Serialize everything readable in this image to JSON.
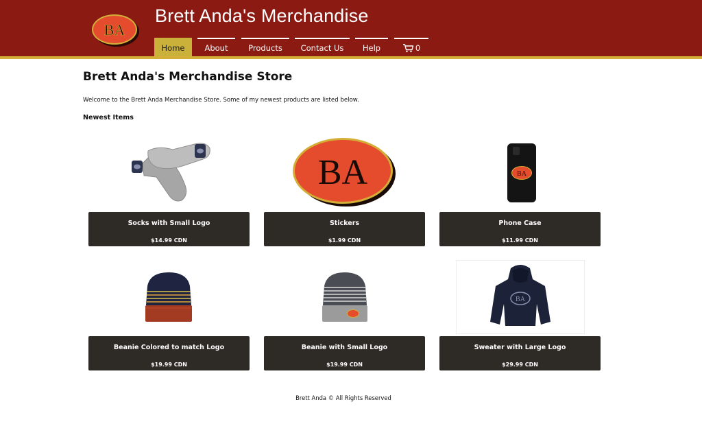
{
  "site": {
    "title": "Brett Anda's Merchandise",
    "logo_text": "BA"
  },
  "nav": {
    "items": [
      {
        "label": "Home",
        "active": true
      },
      {
        "label": "About",
        "active": false
      },
      {
        "label": "Products",
        "active": false
      },
      {
        "label": "Contact Us",
        "active": false
      },
      {
        "label": "Help",
        "active": false
      }
    ],
    "cart_count": "0",
    "cart_icon": "cart-icon"
  },
  "main": {
    "heading": "Brett Anda's Merchandise Store",
    "intro": "Welcome to the Brett Anda Merchandise Store. Some of my newest products are listed below.",
    "subheading": "Newest Items",
    "products": [
      {
        "name": "Socks with Small Logo",
        "price": "$14.99 CDN",
        "image": "socks-image"
      },
      {
        "name": "Stickers",
        "price": "$1.99 CDN",
        "image": "sticker-image"
      },
      {
        "name": "Phone Case",
        "price": "$11.99 CDN",
        "image": "phone-case-image"
      },
      {
        "name": "Beanie Colored to match Logo",
        "price": "$19.99 CDN",
        "image": "striped-beanie-image"
      },
      {
        "name": "Beanie with Small Logo",
        "price": "$19.99 CDN",
        "image": "grey-beanie-image"
      },
      {
        "name": "Sweater with Large Logo",
        "price": "$29.99 CDN",
        "image": "hoodie-image"
      }
    ]
  },
  "footer": {
    "text": "Brett Anda © All Rights Reserved"
  },
  "colors": {
    "header": "#8b1a12",
    "header_rule": "#d4af37",
    "nav_active": "#c9b13a",
    "card": "#2e2a26",
    "logo_red": "#e54b2d"
  }
}
